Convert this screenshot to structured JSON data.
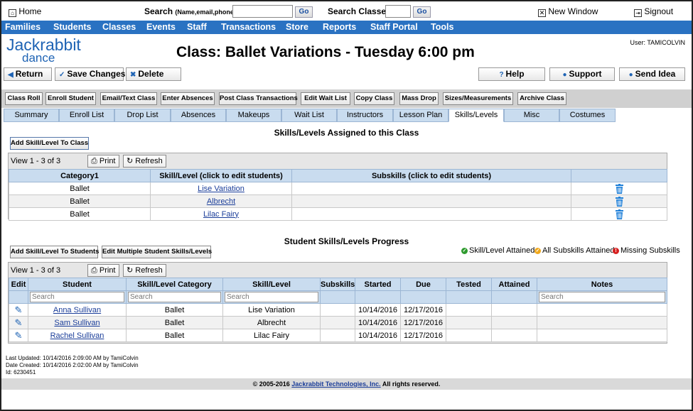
{
  "topbar": {
    "home_label": "Home",
    "search_label": "Search",
    "search_hint": "(Name,email,phone)",
    "go_label": "Go",
    "search_classes_label": "Search Classes:",
    "new_window_label": "New Window",
    "signout_label": "Signout"
  },
  "nav": [
    "Families",
    "Students",
    "Classes",
    "Events",
    "Staff",
    "Transactions",
    "Store",
    "Reports",
    "Staff Portal",
    "Tools"
  ],
  "logo": {
    "line1": "Jackrabbit",
    "line2": "dance",
    "color": "#1e63b4"
  },
  "page_title": "Class: Ballet Variations - Tuesday 6:00 pm",
  "user_label": "User: TAMICOLVIN",
  "actions": {
    "return": "Return",
    "save": "Save Changes",
    "delete": "Delete",
    "help": "Help",
    "support": "Support",
    "send_idea": "Send Idea"
  },
  "toolbar": [
    "Class Roll",
    "Enroll Student",
    "Email/Text Class",
    "Enter Absences",
    "Post Class Transactions",
    "Edit Wait List",
    "Copy Class",
    "Mass Drop",
    "Sizes/Measurements",
    "Archive Class"
  ],
  "tabs": [
    "Summary",
    "Enroll List",
    "Drop List",
    "Absences",
    "Makeups",
    "Wait List",
    "Instructors",
    "Lesson Plan",
    "Skills/Levels",
    "Misc",
    "Costumes"
  ],
  "active_tab": "Skills/Levels",
  "assigned": {
    "heading": "Skills/Levels Assigned to this Class",
    "add_button": "Add Skill/Level To Class",
    "count": "View 1 - 3 of 3",
    "print": "Print",
    "refresh": "Refresh",
    "columns": [
      "Category1",
      "Skill/Level (click to edit students)",
      "Subskills (click to edit students)",
      ""
    ],
    "rows": [
      {
        "category": "Ballet",
        "skill": "Lise Variation",
        "subskills": ""
      },
      {
        "category": "Ballet",
        "skill": "Albrecht",
        "subskills": ""
      },
      {
        "category": "Ballet",
        "skill": "Lilac Fairy",
        "subskills": ""
      }
    ]
  },
  "progress": {
    "heading": "Student Skills/Levels Progress",
    "add_button": "Add Skill/Level To Students",
    "edit_button": "Edit Multiple Student Skills/Levels",
    "legend": [
      {
        "label": "Skill/Level Attained",
        "color": "#2e9b2e",
        "glyph": "✓"
      },
      {
        "label": "All Subskills Attained",
        "color": "#f0a81c",
        "glyph": "✓"
      },
      {
        "label": "Missing Subskills",
        "color": "#d62020",
        "glyph": "!"
      }
    ],
    "count": "View 1 - 3 of 3",
    "print": "Print",
    "refresh": "Refresh",
    "columns": [
      "Edit",
      "Student",
      "Skill/Level Category",
      "Skill/Level",
      "Subskills",
      "Started",
      "Due",
      "Tested",
      "Attained",
      "Notes"
    ],
    "search_placeholder": "Search",
    "rows": [
      {
        "student": "Anna Sullivan",
        "category": "Ballet",
        "skill": "Lise Variation",
        "subskills": "",
        "started": "10/14/2016",
        "due": "12/17/2016",
        "tested": "",
        "attained": "",
        "notes": ""
      },
      {
        "student": "Sam Sullivan",
        "category": "Ballet",
        "skill": "Albrecht",
        "subskills": "",
        "started": "10/14/2016",
        "due": "12/17/2016",
        "tested": "",
        "attained": "",
        "notes": ""
      },
      {
        "student": "Rachel Sullivan",
        "category": "Ballet",
        "skill": "Lilac Fairy",
        "subskills": "",
        "started": "10/14/2016",
        "due": "12/17/2016",
        "tested": "",
        "attained": "",
        "notes": ""
      }
    ]
  },
  "footer": {
    "updated": "Last Updated: 10/14/2016 2:09:00 AM by TamiColvin",
    "created": "Date Created: 10/14/2016 2:02:00 AM by TamiColvin",
    "id": "Id: 6230451",
    "copyright_prefix": "© 2005-2016",
    "copyright_link": "Jackrabbit Technologies, Inc.",
    "copyright_suffix": "All rights reserved."
  }
}
